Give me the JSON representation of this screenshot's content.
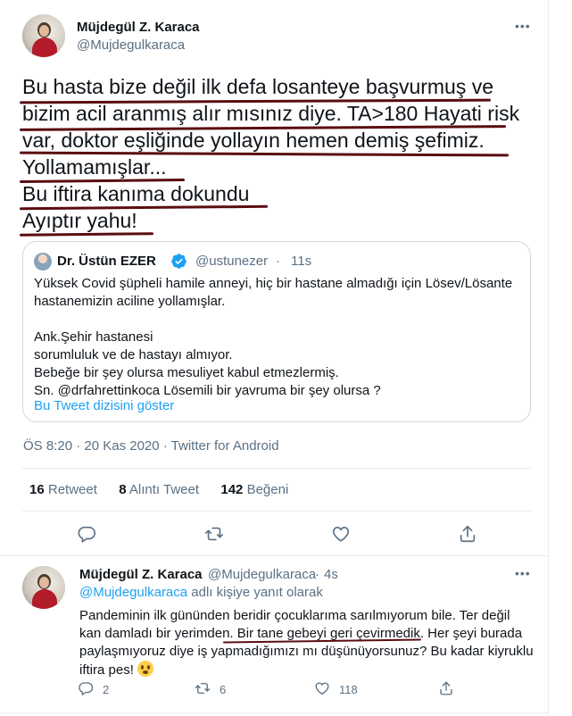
{
  "main_tweet": {
    "author_name": "Müjdegül Z. Karaca",
    "author_handle": "@Mujdegulkaraca",
    "text_lines": [
      "Bu hasta bize değil ilk defa losanteye başvurmuş ve",
      "bizim acil aranmış alır mısınız diye. TA>180 Hayati risk",
      "var, doktor eşliğinde yollayın hemen demiş şefimiz.",
      "Yollamamışlar...",
      "Bu iftira kanıma dokundu",
      "Ayıptır yahu!"
    ],
    "meta": "ÖS 8:20 · 20 Kas 2020 · Twitter for Android",
    "stats": {
      "retweet_count": "16",
      "retweet_label": "Retweet",
      "quote_count": "8",
      "quote_label": "Alıntı Tweet",
      "like_count": "142",
      "like_label": "Beğeni"
    }
  },
  "quoted_tweet": {
    "author_name": "Dr. Üstün EZER",
    "author_handle": "@ustunezer",
    "dot": "·",
    "time": "11s",
    "lines": [
      "Yüksek Covid şüpheli hamile anneyi, hiç bir hastane almadığı için Lösev/Lösante",
      "hastanemizin aciline yollamışlar.",
      "",
      "Ank.Şehir hastanesi",
      "sorumluluk ve de hastayı almıyor.",
      "Bebeğe bir şey olursa mesuliyet kabul etmezlermiş.",
      "Sn. @drfahrettinkoca Lösemili bir yavruma bir şey olursa ?"
    ],
    "thread_link": "Bu Tweet dizisini göster"
  },
  "reply_tweet": {
    "author_name": "Müjdegül Z. Karaca",
    "author_handle": "@Mujdegulkaraca",
    "dot": "·",
    "time": "4s",
    "reply_mention": "@Mujdegulkaraca",
    "reply_suffix": " adlı kişiye yanıt olarak",
    "lines": [
      "Pandeminin ilk gününden beridir çocuklarıma sarılmıyorum bile. Ter değil",
      "kan damladı bir yerimden. Bir tane gebeyi geri çevirmedik. Her şeyi burada",
      "paylaşmıyoruz diye iş yapmadığımızı mı düşünüyorsunuz? Bu kadar kiyruklu",
      "iftira pes! "
    ],
    "reply_count": "2",
    "retweet_count": "6",
    "like_count": "118"
  },
  "icons": {
    "more": "more-icon",
    "reply": "reply-icon",
    "retweet": "retweet-icon",
    "like": "heart-icon",
    "share": "share-icon",
    "verified": "verified-badge-icon",
    "emoji": "flushed-face-emoji"
  },
  "colors": {
    "accent": "#1da1f2",
    "secondary_text": "#5b7083",
    "border": "#e6ecf0",
    "ink_underline": "#5a0d10"
  }
}
